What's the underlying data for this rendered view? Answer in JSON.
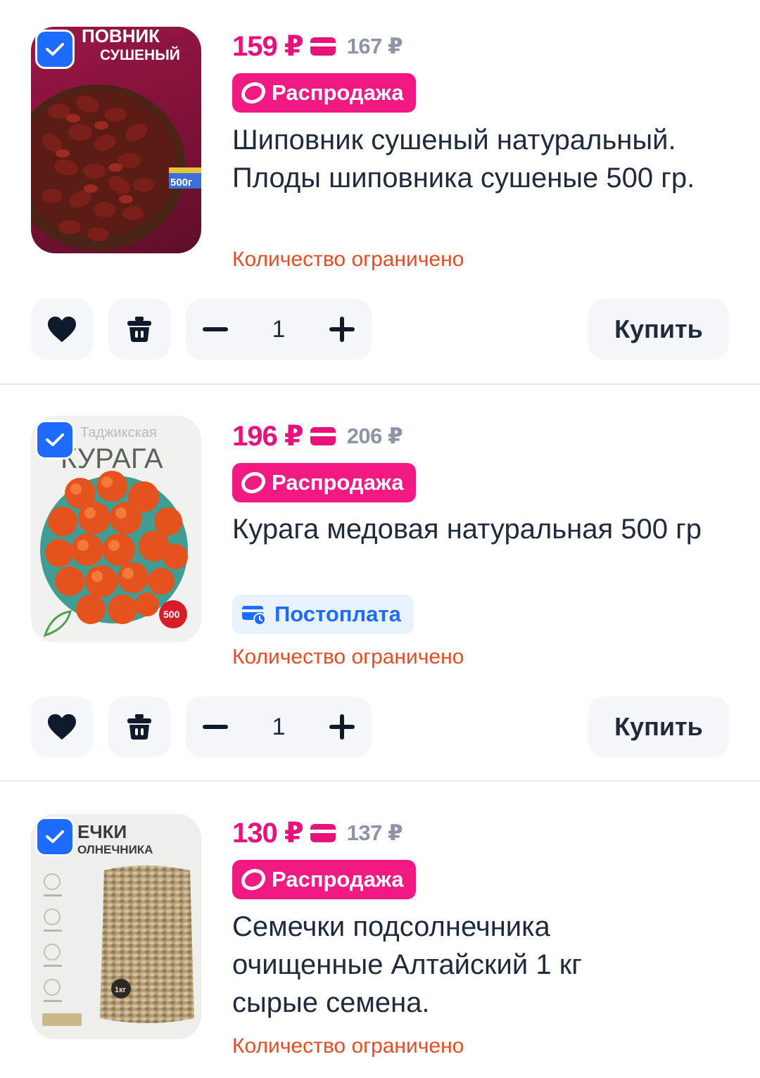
{
  "colors": {
    "accent_pink": "#e8127c",
    "accent_blue": "#1e6bff",
    "warning": "#ec4a22"
  },
  "items": [
    {
      "image_text": [
        "ПОВНИК",
        "СУШЕНЫЙ"
      ],
      "badge_text": "500г",
      "price": "159 ₽",
      "old_price": "167 ₽",
      "badge": "Распродажа",
      "title": "Шиповник сушеный натуральный. Плоды шиповника сушеные 500 гр.",
      "limited": "Количество ограничено",
      "qty": "1",
      "buy": "Купить"
    },
    {
      "image_text": [
        "Таджикская",
        "КУРАГА"
      ],
      "badge_text": "500",
      "price": "196 ₽",
      "old_price": "206 ₽",
      "badge": "Распродажа",
      "title": "Курага медовая натуральная 500 гр",
      "payment": "Постоплата",
      "limited": "Количество ограничено",
      "qty": "1",
      "buy": "Купить"
    },
    {
      "image_text": [
        "ЕЧКИ",
        "ОЛНЕЧНИКА"
      ],
      "badge_text": "1кг",
      "price": "130 ₽",
      "old_price": "137 ₽",
      "badge": "Распродажа",
      "title": "Семечки подсолнечника очищенные Алтайский 1 кг сырые семена.",
      "limited": "Количество ограничено"
    }
  ]
}
